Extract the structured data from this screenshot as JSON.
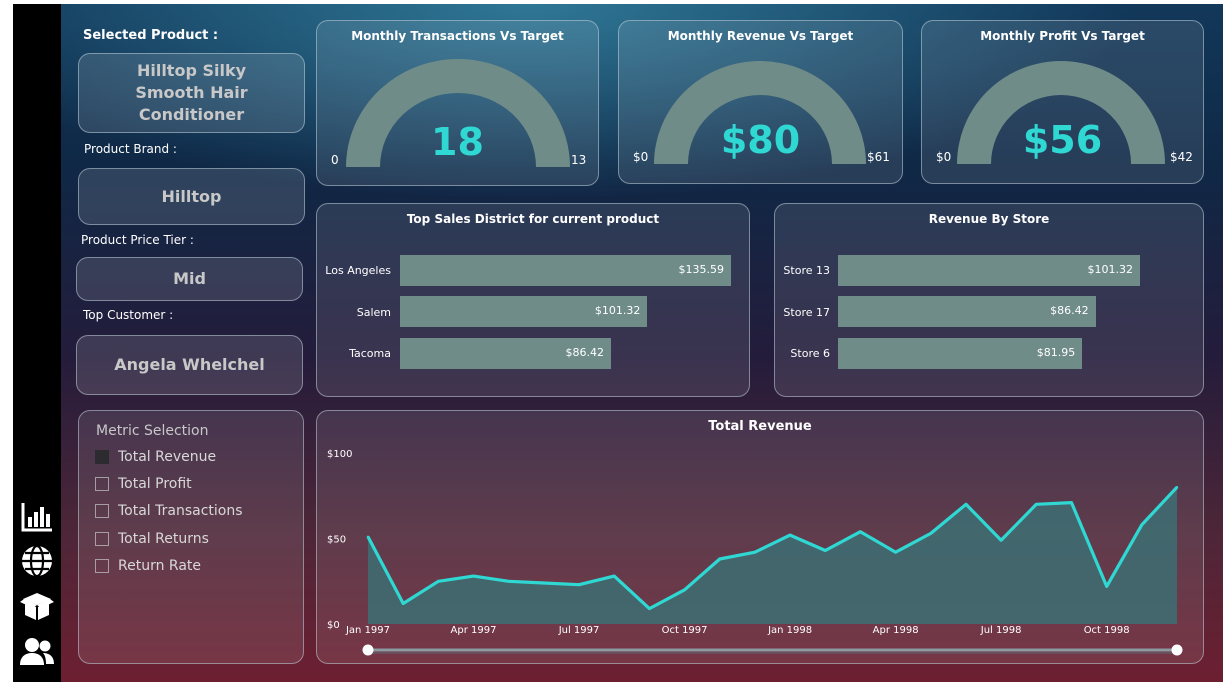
{
  "nav": {
    "icons": [
      "bar-chart-icon",
      "globe-icon",
      "box-icon",
      "users-icon"
    ]
  },
  "product_panel": {
    "selected_label": "Selected Product :",
    "selected_value": "Hilltop Silky Smooth Hair Conditioner",
    "brand_label": "Product Brand :",
    "brand_value": "Hilltop",
    "tier_label": "Product Price Tier :",
    "tier_value": "Mid",
    "customer_label": "Top Customer :",
    "customer_value": "Angela Whelchel"
  },
  "gauges": [
    {
      "title": "Monthly Transactions Vs Target",
      "value": "18",
      "min": "0",
      "max": "13",
      "fill": 1.0
    },
    {
      "title": "Monthly Revenue Vs Target",
      "value": "$80",
      "min": "$0",
      "max": "$61",
      "fill": 1.0
    },
    {
      "title": "Monthly Profit Vs Target",
      "value": "$56",
      "min": "$0",
      "max": "$42",
      "fill": 1.0
    }
  ],
  "districts": {
    "title": "Top Sales District for current product",
    "items": [
      {
        "label": "Los Angeles",
        "value": 135.59,
        "display": "$135.59"
      },
      {
        "label": "Salem",
        "value": 101.32,
        "display": "$101.32"
      },
      {
        "label": "Tacoma",
        "value": 86.42,
        "display": "$86.42"
      }
    ]
  },
  "stores": {
    "title": "Revenue By Store",
    "items": [
      {
        "label": "Store 13",
        "value": 101.32,
        "display": "$101.32"
      },
      {
        "label": "Store 17",
        "value": 86.42,
        "display": "$86.42"
      },
      {
        "label": "Store 6",
        "value": 81.95,
        "display": "$81.95"
      }
    ]
  },
  "metric_selection": {
    "title": "Metric Selection",
    "options": [
      {
        "label": "Total Revenue",
        "checked": true
      },
      {
        "label": "Total Profit",
        "checked": false
      },
      {
        "label": "Total Transactions",
        "checked": false
      },
      {
        "label": "Total Returns",
        "checked": false
      },
      {
        "label": "Return Rate",
        "checked": false
      }
    ]
  },
  "colors": {
    "accent": "#2fd8d2",
    "bar": "#6f8c88",
    "gauge": "#6f8c88",
    "area": "#3f6b71"
  },
  "chart_data": {
    "type": "area",
    "title": "Total Revenue",
    "xlabel": "",
    "ylabel": "",
    "ylim": [
      0,
      100
    ],
    "yticks": [
      "$0",
      "$50",
      "$100"
    ],
    "ytick_values": [
      0,
      50,
      100
    ],
    "xtick_labels": [
      "Jan 1997",
      "Apr 1997",
      "Jul 1997",
      "Oct 1997",
      "Jan 1998",
      "Apr 1998",
      "Jul 1998",
      "Oct 1998"
    ],
    "xtick_indices": [
      0,
      3,
      6,
      9,
      12,
      15,
      18,
      21
    ],
    "x": [
      "Jan 1997",
      "Feb 1997",
      "Mar 1997",
      "Apr 1997",
      "May 1997",
      "Jun 1997",
      "Jul 1997",
      "Aug 1997",
      "Sep 1997",
      "Oct 1997",
      "Nov 1997",
      "Dec 1997",
      "Jan 1998",
      "Feb 1998",
      "Mar 1998",
      "Apr 1998",
      "May 1998",
      "Jun 1998",
      "Jul 1998",
      "Aug 1998",
      "Sep 1998",
      "Oct 1998",
      "Nov 1998",
      "Dec 1998"
    ],
    "series": [
      {
        "values": [
          51,
          12,
          25,
          28,
          25,
          24,
          23,
          28,
          9,
          20,
          38,
          42,
          52,
          43,
          54,
          42,
          53,
          70,
          49,
          70,
          71,
          22,
          58,
          80
        ]
      }
    ],
    "grid": false,
    "legend": "none"
  }
}
